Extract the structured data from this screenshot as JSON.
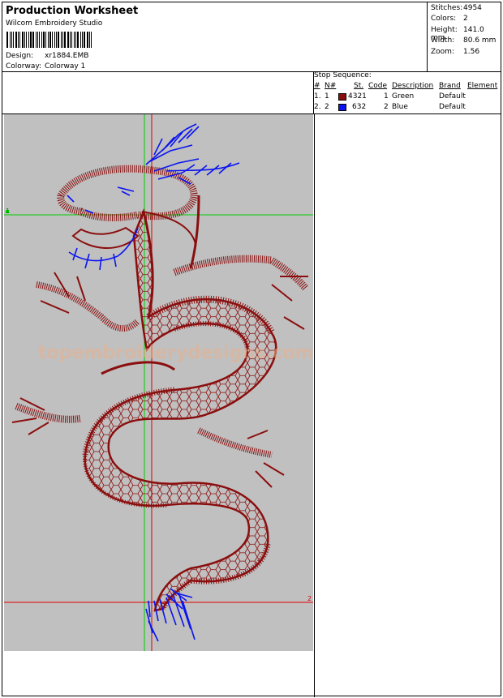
{
  "header": {
    "title": "Production Worksheet",
    "software": "Wilcom Embroidery Studio",
    "design_label": "Design:",
    "design_value": "xr1884.EMB",
    "colorway_label": "Colorway:",
    "colorway_value": "Colorway 1"
  },
  "stats": [
    {
      "label": "Stitches:",
      "value": "4954"
    },
    {
      "label": "Colors:",
      "value": "2"
    },
    {
      "label": "Height:",
      "value": "141.0 mm"
    },
    {
      "label": "Width:",
      "value": "80.6 mm"
    },
    {
      "label": "Zoom:",
      "value": "1.56"
    }
  ],
  "stop_sequence": {
    "caption": "Stop Sequence:",
    "columns": [
      "#",
      "N#",
      "St.",
      "Code",
      "Description",
      "Brand",
      "Element"
    ],
    "rows": [
      {
        "num": "1.",
        "n": "1",
        "color": "#8b0e0e",
        "stitches": "4321",
        "code": "1",
        "description": "Green",
        "brand": "Default",
        "element": ""
      },
      {
        "num": "2.",
        "n": "2",
        "color": "#0a14f0",
        "stitches": "632",
        "code": "2",
        "description": "Blue",
        "brand": "Default",
        "element": ""
      }
    ]
  },
  "canvas": {
    "background": "#c0c0c0",
    "watermark": "topembroiderydesigns.com",
    "marker_top": "1",
    "marker_bottom": "2",
    "guide_green": "#00cc00",
    "guide_red": "#e00000"
  }
}
